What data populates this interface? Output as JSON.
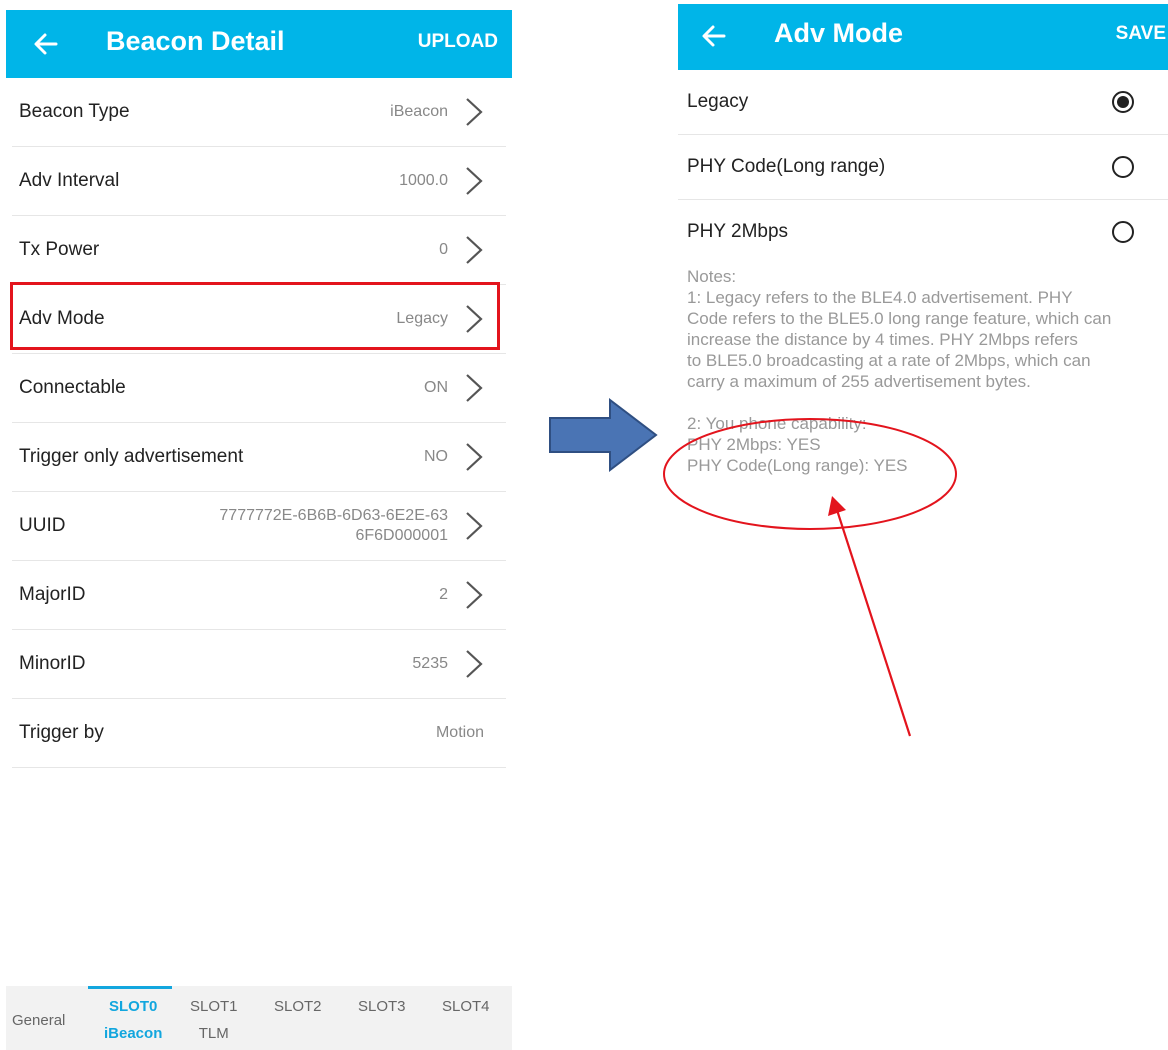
{
  "left": {
    "header": {
      "title": "Beacon Detail",
      "action": "UPLOAD"
    },
    "rows": [
      {
        "label": "Beacon Type",
        "value": "iBeacon"
      },
      {
        "label": "Adv Interval",
        "value": "1000.0"
      },
      {
        "label": "Tx Power",
        "value": "0"
      },
      {
        "label": "Adv Mode",
        "value": "Legacy"
      },
      {
        "label": "Connectable",
        "value": "ON"
      },
      {
        "label": "Trigger only advertisement",
        "value": "NO"
      },
      {
        "label": "UUID",
        "value_line1": "7777772E-6B6B-6D63-6E2E-63",
        "value_line2": "6F6D000001"
      },
      {
        "label": "MajorID",
        "value": "2"
      },
      {
        "label": "MinorID",
        "value": "5235"
      },
      {
        "label": "Trigger by",
        "value": "Motion"
      }
    ],
    "tabs": {
      "general": "General",
      "slot0": "SLOT0",
      "slot0_sub": "iBeacon",
      "slot1": "SLOT1",
      "slot1_sub": "TLM",
      "slot2": "SLOT2",
      "slot3": "SLOT3",
      "slot4": "SLOT4"
    }
  },
  "right": {
    "header": {
      "title": "Adv Mode",
      "action": "SAVE"
    },
    "options": [
      {
        "label": "Legacy",
        "checked": true
      },
      {
        "label": "PHY Code(Long range)",
        "checked": false
      },
      {
        "label": "PHY 2Mbps",
        "checked": false
      }
    ],
    "notes": {
      "heading": "Notes:",
      "line1": "1: Legacy refers to the BLE4.0 advertisement. PHY",
      "line2": "Code refers to the BLE5.0 long range feature, which can",
      "line3": "increase the distance by 4 times. PHY 2Mbps refers",
      "line4": "to BLE5.0 broadcasting at a rate of 2Mbps, which can",
      "line5": "carry a maximum of 255 advertisement bytes.",
      "cap_heading": "2: You phone capability:",
      "cap_2m": "PHY 2Mbps: YES",
      "cap_long": "PHY Code(Long range): YES"
    }
  },
  "colors": {
    "header": "#00b5e8",
    "highlight": "#e3141d",
    "arrow": "#4a74b4",
    "annotation": "#e3141d"
  }
}
